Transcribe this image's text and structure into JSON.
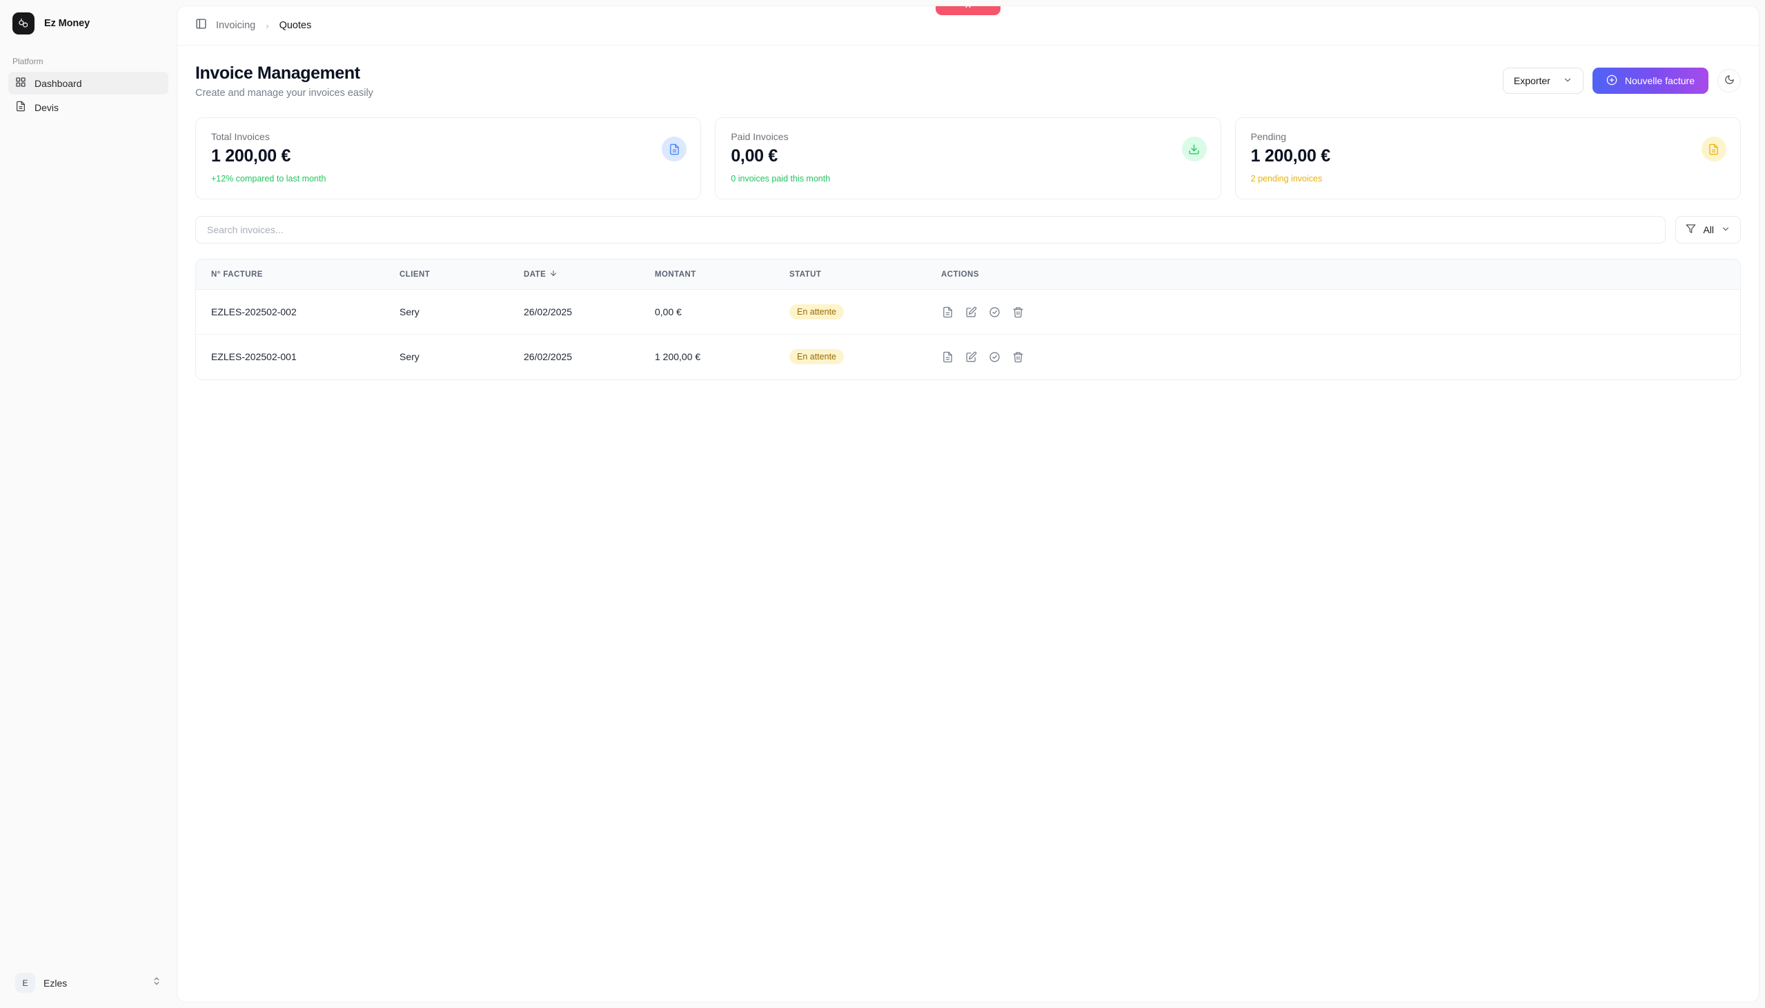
{
  "sidebar": {
    "brand": {
      "name": "Ez Money",
      "logo_icon": "laravel-logo-icon"
    },
    "group_label": "Platform",
    "items": [
      {
        "label": "Dashboard",
        "icon": "grid-icon",
        "active": true
      },
      {
        "label": "Devis",
        "icon": "document-icon",
        "active": false
      }
    ],
    "user": {
      "initial": "E",
      "name": "Ezles",
      "chevron_icon": "chevrons-up-down-icon"
    }
  },
  "topbar": {
    "sidebar_toggle_icon": "panel-left-icon",
    "breadcrumb": [
      {
        "label": "Invoicing",
        "current": false
      },
      {
        "label": "Quotes",
        "current": true
      }
    ],
    "separator": "›"
  },
  "page": {
    "title": "Invoice Management",
    "subtitle": "Create and manage your invoices easily"
  },
  "header_actions": {
    "export_label": "Exporter",
    "export_chevron_icon": "chevron-down-icon",
    "new_invoice_label": "Nouvelle facture",
    "new_invoice_icon": "plus-circle-icon",
    "theme_toggle_icon": "moon-icon",
    "gradient_from": "#4f63f5",
    "gradient_to": "#a74bea"
  },
  "stats": [
    {
      "label": "Total Invoices",
      "value": "1 200,00 €",
      "note": "+12% compared to last month",
      "note_color": "#22c55e",
      "icon": "file-text-icon",
      "icon_bg": "#dbe8fe",
      "icon_color": "#3b82f6"
    },
    {
      "label": "Paid Invoices",
      "value": "0,00 €",
      "note": "0 invoices paid this month",
      "note_color": "#22c55e",
      "icon": "download-icon",
      "icon_bg": "#d9fbe7",
      "icon_color": "#22c55e"
    },
    {
      "label": "Pending",
      "value": "1 200,00 €",
      "note": "2 pending invoices",
      "note_color": "#eab308",
      "icon": "file-text-icon",
      "icon_bg": "#fdf4cc",
      "icon_color": "#eab308"
    }
  ],
  "toolbar": {
    "search_placeholder": "Search invoices...",
    "search_value": "",
    "filter_label": "All",
    "filter_icon": "funnel-icon",
    "filter_chevron_icon": "chevron-down-icon"
  },
  "table": {
    "columns": [
      {
        "key": "number",
        "label": "N° FACTURE",
        "sorted": false
      },
      {
        "key": "client",
        "label": "CLIENT",
        "sorted": false
      },
      {
        "key": "date",
        "label": "DATE",
        "sorted": true,
        "sort_icon": "arrow-down-icon"
      },
      {
        "key": "amount",
        "label": "MONTANT",
        "sorted": false
      },
      {
        "key": "status",
        "label": "STATUT",
        "sorted": false
      },
      {
        "key": "actions",
        "label": "ACTIONS",
        "sorted": false
      }
    ],
    "rows": [
      {
        "number": "EZLES-202502-002",
        "client": "Sery",
        "date": "26/02/2025",
        "amount": "0,00 €",
        "status": "En attente",
        "status_bg": "#fdf4cc",
        "status_color": "#9a6b06",
        "actions": [
          "file-text-icon",
          "edit-square-icon",
          "check-circle-icon",
          "trash-icon"
        ]
      },
      {
        "number": "EZLES-202502-001",
        "client": "Sery",
        "date": "26/02/2025",
        "amount": "1 200,00 €",
        "status": "En attente",
        "status_bg": "#fdf4cc",
        "status_color": "#9a6b06",
        "actions": [
          "file-text-icon",
          "edit-square-icon",
          "check-circle-icon",
          "trash-icon"
        ]
      }
    ]
  },
  "notification_pill": {
    "color": "#f4556b",
    "icon": "chevron-up-icon"
  }
}
